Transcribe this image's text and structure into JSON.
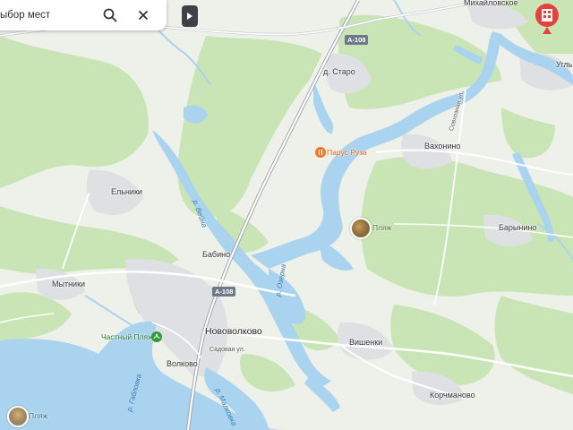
{
  "search": {
    "placeholder": "ыбор мест",
    "search_icon": "search-icon",
    "close_icon": "close-icon"
  },
  "side_panel_toggle_icon": "play-triangle-icon",
  "colors": {
    "water": "#a9d3ee",
    "forest": "#c9e5b5",
    "field": "#eef0ea",
    "settlement": "#dfe0e3",
    "road": "#ffffff",
    "poi_orange": "#f07a2c",
    "poi_green": "#2f9a3a",
    "poi_red": "#e8413b"
  },
  "labels": {
    "mikhailovskoe": "Михайловское",
    "ugly": "Угль",
    "staro": "д. Старо",
    "vakhonino": "Вахонино",
    "sovkhoznaya": "Совхозная ул.",
    "yelniki": "Ельники",
    "barynino": "Барынино",
    "babino": "Бабино",
    "mytniki": "Мытники",
    "novovolkovo": "Нововолково",
    "volkovo": "Волково",
    "sadovaya": "Садовая ул.",
    "vishenki": "Вишенки",
    "korchmanovo": "Корчманово",
    "river_vedna": "р. Вейна",
    "river_ozerna": "р. Озерна",
    "river_gablovka": "р. Габловка",
    "river_malkovka": "р. Малковка"
  },
  "roads": {
    "a108_top": "А-108",
    "a108_mid": "А-108"
  },
  "pois": {
    "parus_ruza": {
      "label": "Парус Руза",
      "icon": "restaurant-icon"
    },
    "plyazh_1": {
      "label": "Пляж",
      "icon": "beach-photo-icon"
    },
    "chastny_plyazh": {
      "label": "Частный Пляж",
      "icon": "beach-icon"
    },
    "plyazh_2": {
      "label": "Пляж",
      "icon": "beach-photo-icon"
    },
    "building": {
      "icon": "building-icon"
    }
  }
}
